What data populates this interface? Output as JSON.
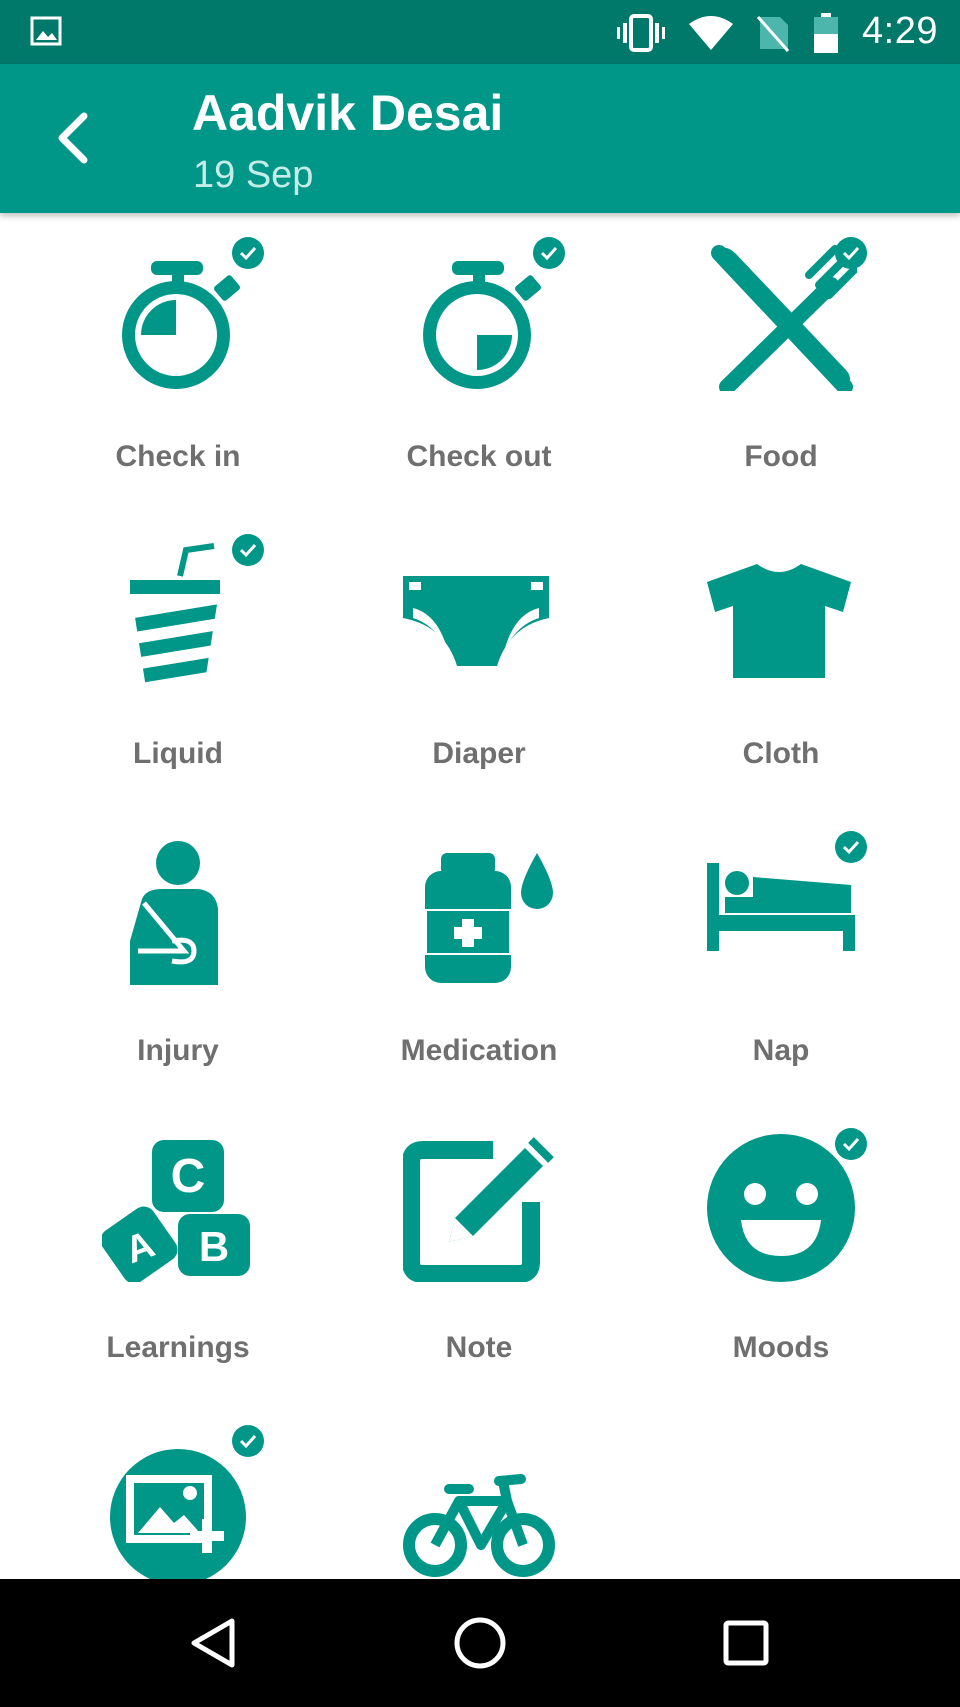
{
  "status_bar": {
    "time": "4:29",
    "icons": [
      "gallery-icon",
      "vibrate-icon",
      "wifi-icon",
      "no-sim-icon",
      "battery-icon"
    ]
  },
  "toolbar": {
    "title": "Aadvik Desai",
    "subtitle": "19 Sep",
    "back_icon": "back-arrow-icon"
  },
  "colors": {
    "status_bar": "#00796b",
    "toolbar": "#009688",
    "accent": "#009688",
    "label": "#6f6f6f",
    "nav_bar": "#000000"
  },
  "activities": [
    {
      "label": "Check in",
      "icon": "stopwatch-checkin-icon",
      "checked": true
    },
    {
      "label": "Check out",
      "icon": "stopwatch-checkout-icon",
      "checked": true
    },
    {
      "label": "Food",
      "icon": "knife-fork-icon",
      "checked": true
    },
    {
      "label": "Liquid",
      "icon": "drink-cup-icon",
      "checked": true
    },
    {
      "label": "Diaper",
      "icon": "diaper-icon",
      "checked": false
    },
    {
      "label": "Cloth",
      "icon": "tshirt-icon",
      "checked": false
    },
    {
      "label": "Injury",
      "icon": "arm-sling-icon",
      "checked": false
    },
    {
      "label": "Medication",
      "icon": "medicine-bottle-icon",
      "checked": false
    },
    {
      "label": "Nap",
      "icon": "bed-icon",
      "checked": true
    },
    {
      "label": "Learnings",
      "icon": "abc-blocks-icon",
      "checked": false
    },
    {
      "label": "Note",
      "icon": "note-edit-icon",
      "checked": false
    },
    {
      "label": "Moods",
      "icon": "smiley-icon",
      "checked": true
    },
    {
      "label": "",
      "icon": "add-photo-icon",
      "checked": true
    },
    {
      "label": "",
      "icon": "bicycle-icon",
      "checked": false
    }
  ],
  "nav_bar": {
    "buttons": [
      "back-triangle-icon",
      "home-circle-icon",
      "recents-square-icon"
    ]
  }
}
